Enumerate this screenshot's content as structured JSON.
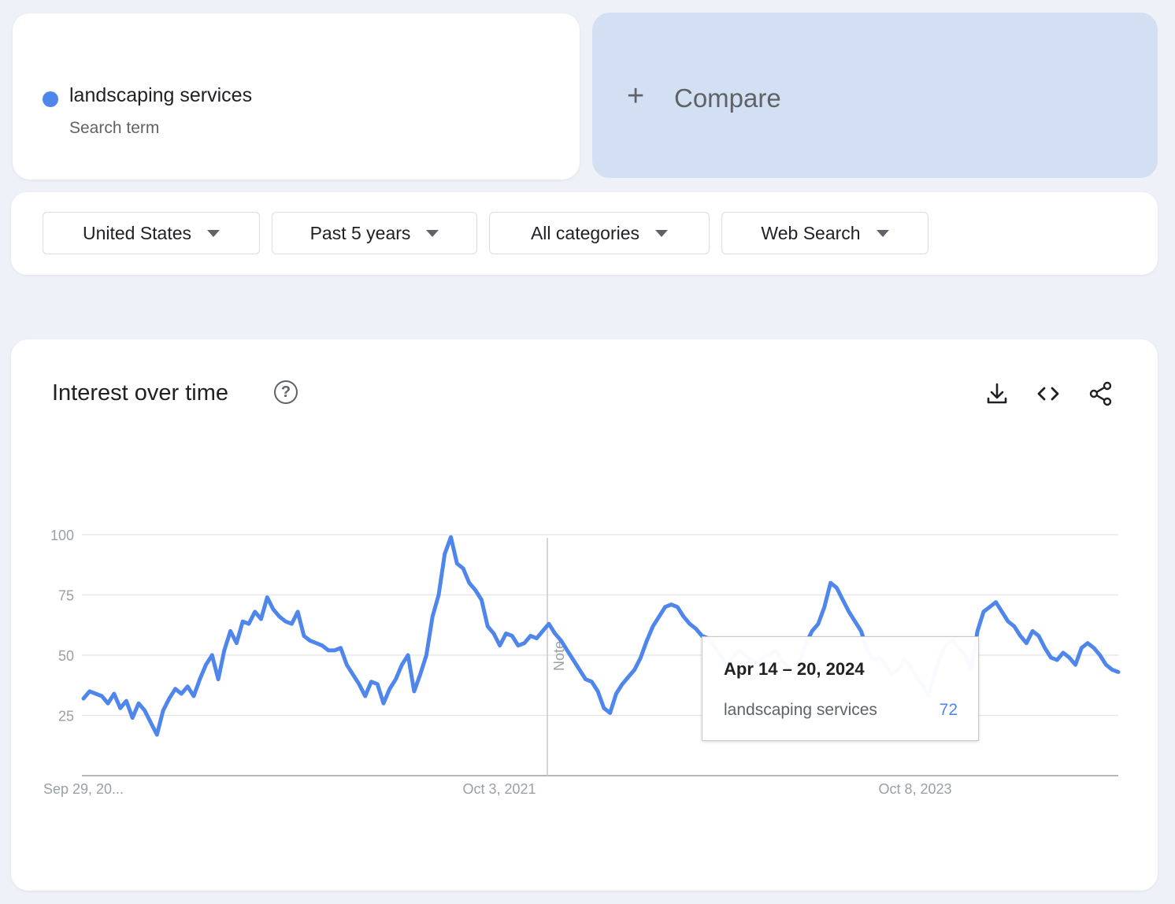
{
  "term": {
    "name": "landscaping services",
    "subtitle": "Search term",
    "color": "#4f86ec"
  },
  "compare": {
    "plus": "+",
    "label": "Compare"
  },
  "filters": {
    "region": "United States",
    "period": "Past 5 years",
    "category": "All categories",
    "search_type": "Web Search"
  },
  "chart_section": {
    "title": "Interest over time",
    "help_glyph": "?",
    "note_label": "Note",
    "icons": [
      "download-icon",
      "embed-code-icon",
      "share-icon"
    ]
  },
  "tooltip": {
    "date": "Apr 14 – 20, 2024",
    "series": "landscaping services",
    "value": "72"
  },
  "chart_data": {
    "type": "line",
    "title": "Interest over time",
    "y_ticks": [
      "100",
      "75",
      "50",
      "25"
    ],
    "ylim": [
      0,
      100
    ],
    "x_tick_labels": [
      "Sep 29, 20...",
      "Oct 3, 2021",
      "Oct 8, 2023"
    ],
    "grid": true,
    "series": [
      {
        "name": "landscaping services",
        "color": "#4f86ec",
        "values": [
          32,
          35,
          34,
          33,
          30,
          34,
          28,
          31,
          24,
          30,
          27,
          22,
          17,
          27,
          32,
          36,
          34,
          37,
          33,
          40,
          46,
          50,
          40,
          52,
          60,
          55,
          64,
          63,
          68,
          65,
          74,
          69,
          66,
          64,
          63,
          68,
          58,
          56,
          55,
          54,
          52,
          52,
          53,
          46,
          42,
          38,
          33,
          39,
          38,
          30,
          36,
          40,
          46,
          50,
          35,
          42,
          50,
          66,
          75,
          92,
          99,
          88,
          86,
          80,
          77,
          73,
          62,
          59,
          54,
          59,
          58,
          54,
          55,
          58,
          57,
          60,
          63,
          59,
          56,
          52,
          48,
          44,
          40,
          39,
          35,
          28,
          26,
          34,
          38,
          41,
          44,
          49,
          56,
          62,
          66,
          70,
          71,
          70,
          66,
          63,
          61,
          58,
          57,
          54,
          50,
          46,
          49,
          52,
          50,
          48,
          47,
          49,
          50,
          52,
          48,
          45,
          43,
          48,
          55,
          60,
          63,
          70,
          80,
          78,
          73,
          68,
          64,
          60,
          52,
          48,
          49,
          46,
          42,
          44,
          48,
          46,
          41,
          38,
          33,
          42,
          50,
          55,
          56,
          53,
          50,
          44,
          60,
          68,
          70,
          72,
          68,
          64,
          62,
          58,
          55,
          60,
          58,
          53,
          49,
          48,
          51,
          49,
          46,
          53,
          55,
          53,
          50,
          46,
          44,
          43
        ]
      }
    ]
  }
}
